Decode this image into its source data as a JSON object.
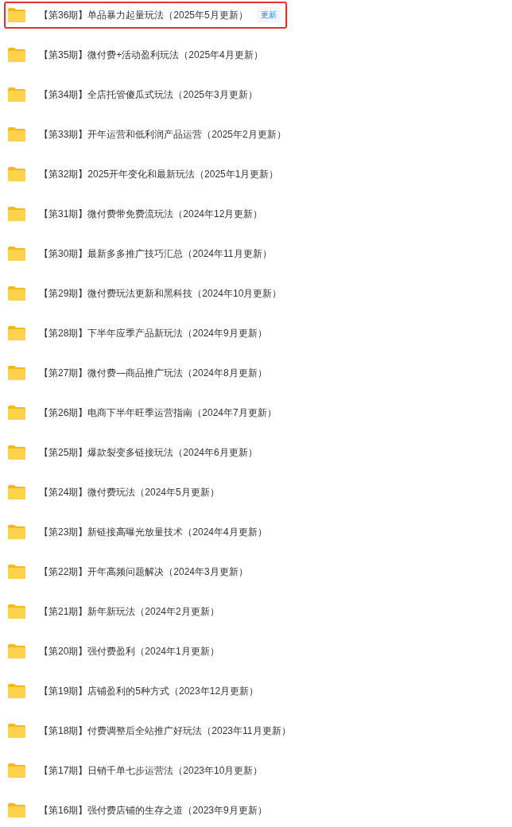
{
  "folders": [
    {
      "title": "【第36期】单品暴力起量玩法（2025年5月更新）",
      "selected": true,
      "badge": "更新"
    },
    {
      "title": "【第35期】微付费+活动盈利玩法（2025年4月更新）",
      "selected": false
    },
    {
      "title": "【第34期】全店托管傻瓜式玩法（2025年3月更新）",
      "selected": false
    },
    {
      "title": "【第33期】开年运营和低利润产品运营（2025年2月更新）",
      "selected": false
    },
    {
      "title": "【第32期】2025开年变化和最新玩法（2025年1月更新）",
      "selected": false
    },
    {
      "title": "【第31期】微付费带免费流玩法（2024年12月更新）",
      "selected": false
    },
    {
      "title": "【第30期】最新多多推广技巧汇总（2024年11月更新）",
      "selected": false
    },
    {
      "title": "【第29期】微付费玩法更新和黑科技（2024年10月更新）",
      "selected": false
    },
    {
      "title": "【第28期】下半年应季产品新玩法（2024年9月更新）",
      "selected": false
    },
    {
      "title": "【第27期】微付费—商品推广玩法（2024年8月更新）",
      "selected": false
    },
    {
      "title": "【第26期】电商下半年旺季运营指南（2024年7月更新）",
      "selected": false
    },
    {
      "title": "【第25期】爆款裂变多链接玩法（2024年6月更新）",
      "selected": false
    },
    {
      "title": "【第24期】微付费玩法（2024年5月更新）",
      "selected": false
    },
    {
      "title": "【第23期】新链接高曝光放量技术（2024年4月更新）",
      "selected": false
    },
    {
      "title": "【第22期】开年高频问题解决（2024年3月更新）",
      "selected": false
    },
    {
      "title": "【第21期】新年新玩法（2024年2月更新）",
      "selected": false
    },
    {
      "title": "【第20期】强付费盈利（2024年1月更新）",
      "selected": false
    },
    {
      "title": "【第19期】店铺盈利的5种方式（2023年12月更新）",
      "selected": false
    },
    {
      "title": "【第18期】付费调整后全站推广好玩法（2023年11月更新）",
      "selected": false
    },
    {
      "title": "【第17期】日销千单七步运营法（2023年10月更新）",
      "selected": false
    },
    {
      "title": "【第16期】强付费店铺的生存之道（2023年9月更新）",
      "selected": false
    }
  ]
}
